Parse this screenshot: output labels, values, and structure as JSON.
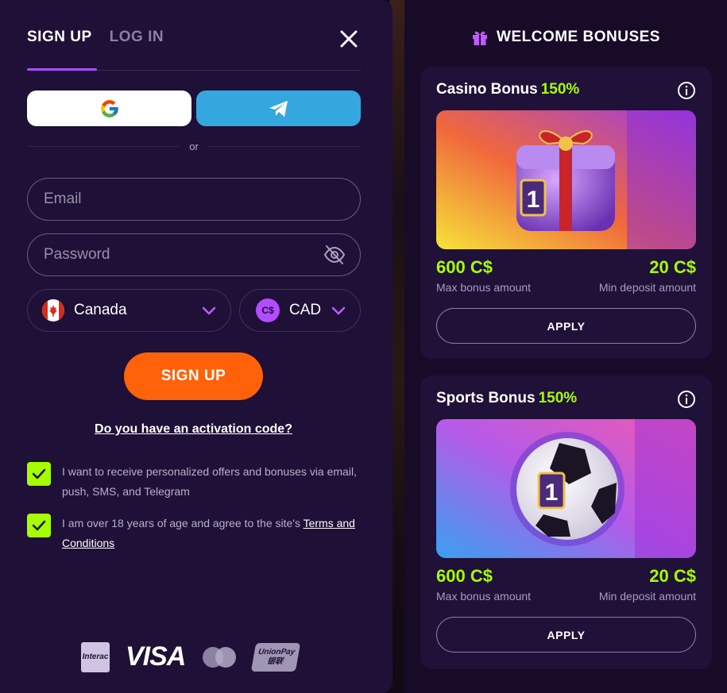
{
  "auth": {
    "tabs": [
      {
        "label": "SIGN UP",
        "active": true
      },
      {
        "label": "LOG IN",
        "active": false
      }
    ],
    "divider_text": "or",
    "email_placeholder": "Email",
    "password_placeholder": "Password",
    "country": "Canada",
    "currency": "CAD",
    "currency_badge": "C$",
    "signup_label": "SIGN UP",
    "activation_link": "Do you have an activation code?",
    "consents": [
      {
        "text": "I want to receive personalized offers and bonuses via email, push, SMS, and Telegram",
        "checked": true
      },
      {
        "text": "I am over 18 years of age and agree to the site's ",
        "link": "Terms and Conditions",
        "checked": true
      }
    ],
    "payment_methods": [
      "Interac",
      "VISA",
      "mastercard-icon",
      "UnionPay"
    ],
    "payment_labels": {
      "interac": "Interac",
      "visa": "VISA",
      "unionpay_top": "UnionPay",
      "unionpay_bottom": "银联"
    }
  },
  "bonuses": {
    "title": "WELCOME BONUSES",
    "items": [
      {
        "name": "Casino Bonus",
        "percent": "150%",
        "image": "fluffy-gift-box",
        "max_amount": "600 C$",
        "max_label": "Max bonus amount",
        "min_amount": "20 C$",
        "min_label": "Min deposit amount",
        "apply_label": "APPLY"
      },
      {
        "name": "Sports Bonus",
        "percent": "150%",
        "image": "fluffy-soccer-ball",
        "max_amount": "600 C$",
        "max_label": "Max bonus amount",
        "min_amount": "20 C$",
        "min_label": "Min deposit amount",
        "apply_label": "APPLY"
      }
    ]
  },
  "colors": {
    "accent_purple": "#b14cff",
    "signup_orange": "#ff6208",
    "lime": "#a6ff00",
    "telegram_blue": "#34a8de",
    "panel_bg": "#1e1036"
  }
}
